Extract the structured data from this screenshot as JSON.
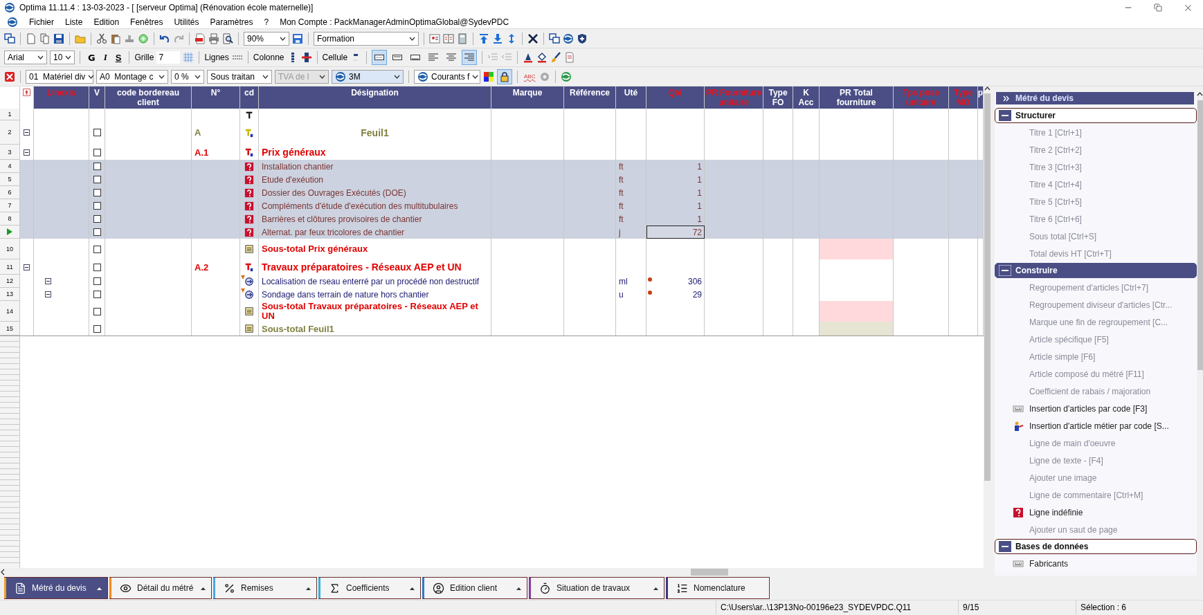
{
  "window": {
    "title": "Optima 11.11.4 : 13-03-2023 - [ [serveur Optima] (Rénovation école maternelle)]"
  },
  "menu": [
    "Fichier",
    "Liste",
    "Edition",
    "Fenêtres",
    "Utilités",
    "Paramètres",
    "?"
  ],
  "account": "Mon Compte : PackManagerAdminOptimaGlobal@SydevPDC",
  "toolbar_main": {
    "zoom": "90%",
    "profile": "Formation"
  },
  "toolbar_format": {
    "font": "Arial",
    "size": "10",
    "bold": "G",
    "italic": "I",
    "strike": "S",
    "grid_label": "Grille",
    "grid_value": "7",
    "lines_label": "Lignes",
    "columns_label": "Colonne",
    "cell_label": "Cellule"
  },
  "format_toggles": [
    {
      "selected": true
    },
    {
      "selected": false
    },
    {
      "selected": false
    },
    {
      "selected": false
    },
    {
      "selected": false
    },
    {
      "selected": true
    }
  ],
  "toolbar_filters": {
    "lot": "01  Matériel div",
    "subgroup": "A0  Montage c",
    "rate": "0 %",
    "supplier": "Sous traitan",
    "vat": {
      "value": "TVA de l",
      "disabled": true
    },
    "brand": "3M",
    "currents": "Courants f",
    "spell": "ABC",
    "lock_on": true
  },
  "columns": [
    {
      "label": "Linexis",
      "highlighted": true
    },
    {
      "label": "V",
      "highlighted": false
    },
    {
      "label": "code bordereau client",
      "highlighted": false
    },
    {
      "label": "N°",
      "highlighted": false
    },
    {
      "label": "cd",
      "highlighted": false
    },
    {
      "label": "Désignation",
      "highlighted": false
    },
    {
      "label": "Marque",
      "highlighted": false
    },
    {
      "label": "Référence",
      "highlighted": false
    },
    {
      "label": "Uté",
      "highlighted": false
    },
    {
      "label": "Qté",
      "highlighted": true
    },
    {
      "label": "PR Fourniture unitaire",
      "highlighted": true
    },
    {
      "label": "Type FO",
      "highlighted": false
    },
    {
      "label": "K Acc",
      "highlighted": false
    },
    {
      "label": "PR Total fourniture",
      "highlighted": false
    },
    {
      "label": "Tps pose unitaire",
      "highlighted": true
    },
    {
      "label": "Type MO",
      "highlighted": true
    },
    {
      "label": "p",
      "highlighted": false
    }
  ],
  "rows": [
    {
      "number": "1",
      "kind": "heading",
      "selected": false,
      "current": false
    },
    {
      "number": "2",
      "kind": "title1",
      "selected": false,
      "current": false,
      "group_toggle": {
        "expanded": true
      },
      "checkbox": {
        "checked": false
      },
      "index": "A",
      "designation": "Feuil1"
    },
    {
      "number": "3",
      "kind": "title2",
      "selected": false,
      "current": false,
      "group_toggle": {
        "expanded": true
      },
      "checkbox": {
        "checked": false
      },
      "index": "A.1",
      "designation": "Prix généraux"
    },
    {
      "number": "4",
      "kind": "undefined",
      "selected": true,
      "current": false,
      "checkbox": {
        "checked": false
      },
      "designation": "Installation chantier",
      "unit": "ft",
      "qty": "1"
    },
    {
      "number": "5",
      "kind": "undefined",
      "selected": true,
      "current": false,
      "checkbox": {
        "checked": false
      },
      "designation": "Etude d'exéution",
      "unit": "ft",
      "qty": "1"
    },
    {
      "number": "6",
      "kind": "undefined",
      "selected": true,
      "current": false,
      "checkbox": {
        "checked": false
      },
      "designation": "Dossier des Ouvrages Exécutés (DOE)",
      "unit": "ft",
      "qty": "1"
    },
    {
      "number": "7",
      "kind": "undefined",
      "selected": true,
      "current": false,
      "checkbox": {
        "checked": false
      },
      "designation": "Compléments d'étude d'exécution des multitubulaires",
      "unit": "ft",
      "qty": "1"
    },
    {
      "number": "8",
      "kind": "undefined",
      "selected": true,
      "current": false,
      "checkbox": {
        "checked": false
      },
      "designation": "Barrières et clôtures provisoires de chantier",
      "unit": "ft",
      "qty": "1"
    },
    {
      "kind": "undefined",
      "selected": true,
      "current": true,
      "checkbox": {
        "checked": false
      },
      "designation": "Alternat. par feux tricolores de chantier",
      "unit": "j",
      "qty": "72"
    },
    {
      "number": "10",
      "kind": "subtotal2",
      "selected": false,
      "current": false,
      "checkbox": {
        "checked": false
      },
      "designation": "Sous-total Prix généraux",
      "color": "#ffd9dc"
    },
    {
      "number": "11",
      "kind": "title2",
      "selected": false,
      "current": false,
      "group_toggle": {
        "expanded": true
      },
      "checkbox": {
        "checked": false
      },
      "index": "A.2",
      "designation": "Travaux préparatoires - Réseaux AEP et UN"
    },
    {
      "number": "12",
      "kind": "article",
      "selected": false,
      "current": false,
      "annotated": true,
      "article_toggle": {
        "expanded": true
      },
      "checkbox": {
        "checked": false
      },
      "designation": "Localisation de rseau enterré par un procédé non destructif",
      "unit": "ml",
      "qty": "306"
    },
    {
      "number": "13",
      "kind": "article",
      "selected": false,
      "current": false,
      "annotated": true,
      "article_toggle": {
        "expanded": true
      },
      "checkbox": {
        "checked": false
      },
      "designation": "Sondage dans terrain de nature hors chantier",
      "unit": "u",
      "qty": "29"
    },
    {
      "number": "14",
      "kind": "subtotal2",
      "selected": false,
      "current": false,
      "checkbox": {
        "checked": false
      },
      "designation": "Sous-total Travaux préparatoires - Réseaux AEP et UN",
      "color": "#ffd9dc"
    },
    {
      "number": "15",
      "kind": "subtotal1",
      "selected": false,
      "current": false,
      "checkbox": {
        "checked": false
      },
      "designation": "Sous-total Feuil1",
      "color": "#e6e4d2"
    }
  ],
  "panel": {
    "title": "Métré du devis",
    "sections": [
      {
        "title": "Structurer",
        "selected": false,
        "expanded": true,
        "items": [
          {
            "label": "Titre 1 [Ctrl+1]",
            "kind": "plain",
            "disabled": true
          },
          {
            "label": "Titre 2 [Ctrl+2]",
            "kind": "plain",
            "disabled": true
          },
          {
            "label": "Titre 3 [Ctrl+3]",
            "kind": "plain",
            "disabled": true
          },
          {
            "label": "Titre 4 [Ctrl+4]",
            "kind": "plain",
            "disabled": true
          },
          {
            "label": "Titre 5 [Ctrl+5]",
            "kind": "plain",
            "disabled": true
          },
          {
            "label": "Titre 6 [Ctrl+6]",
            "kind": "plain",
            "disabled": true
          },
          {
            "label": "Sous total [Ctrl+S]",
            "kind": "plain",
            "disabled": true
          },
          {
            "label": "Total devis HT [Ctrl+T]",
            "kind": "plain",
            "disabled": true
          }
        ]
      },
      {
        "title": "Construire",
        "selected": true,
        "expanded": true,
        "items": [
          {
            "label": "Regroupement d'articles  [Ctrl+7]",
            "kind": "plain",
            "disabled": true
          },
          {
            "label": "Regroupement diviseur d'articles [Ctr...",
            "kind": "plain",
            "disabled": true
          },
          {
            "label": "Marque une fin de regroupement  [C...",
            "kind": "plain",
            "disabled": true
          },
          {
            "label": "Article spécifique [F5]",
            "kind": "plain",
            "disabled": true
          },
          {
            "label": "Article simple [F6]",
            "kind": "plain",
            "disabled": true
          },
          {
            "label": "Article composé du métré [F11]",
            "kind": "plain",
            "disabled": true
          },
          {
            "label": "Coefficient de rabais / majoration",
            "kind": "plain",
            "disabled": true
          },
          {
            "label": "Insertion d'articles par code [F3]",
            "kind": "code",
            "disabled": false
          },
          {
            "label": "Insertion d'article métier par code [S...",
            "kind": "worker",
            "disabled": false
          },
          {
            "label": "Ligne de main d'oeuvre",
            "kind": "plain",
            "disabled": true
          },
          {
            "label": "Ligne de texte - [F4]",
            "kind": "plain",
            "disabled": true
          },
          {
            "label": "Ajouter une image",
            "kind": "plain",
            "disabled": true
          },
          {
            "label": "Ligne de commentaire [Ctrl+M]",
            "kind": "plain",
            "disabled": true
          },
          {
            "label": "Ligne indéfinie",
            "kind": "undefined",
            "disabled": false
          },
          {
            "label": "Ajouter un saut de page",
            "kind": "plain",
            "disabled": true
          }
        ]
      },
      {
        "title": "Bases de données",
        "selected": false,
        "expanded": true,
        "items": [
          {
            "label": "Fabricants",
            "kind": "code",
            "disabled": false
          }
        ]
      }
    ]
  },
  "tabs": [
    {
      "label": "Métré du devis",
      "selected": true,
      "menu": true,
      "color": "#f0a020"
    },
    {
      "label": "Détail du métré",
      "selected": false,
      "menu": true,
      "color": "#f08a20"
    },
    {
      "label": "Remises",
      "selected": false,
      "menu": true,
      "color": "#4aa8e8"
    },
    {
      "label": "Coefficients",
      "selected": false,
      "menu": true,
      "color": "#30b4d8"
    },
    {
      "label": "Edition client",
      "selected": false,
      "menu": true,
      "color": "#2a7cc8"
    },
    {
      "label": "Situation de travaux",
      "selected": false,
      "menu": true,
      "color": "#8a3aa0"
    },
    {
      "label": "Nomenclature",
      "selected": false,
      "menu": false,
      "color": "#3a3a80"
    }
  ],
  "status_bar": {
    "path": "C:\\Users\\ar..\\13P13No-00196e23_SYDEVPDC.Q11",
    "position": "9/15",
    "selection": "Sélection : 6"
  }
}
